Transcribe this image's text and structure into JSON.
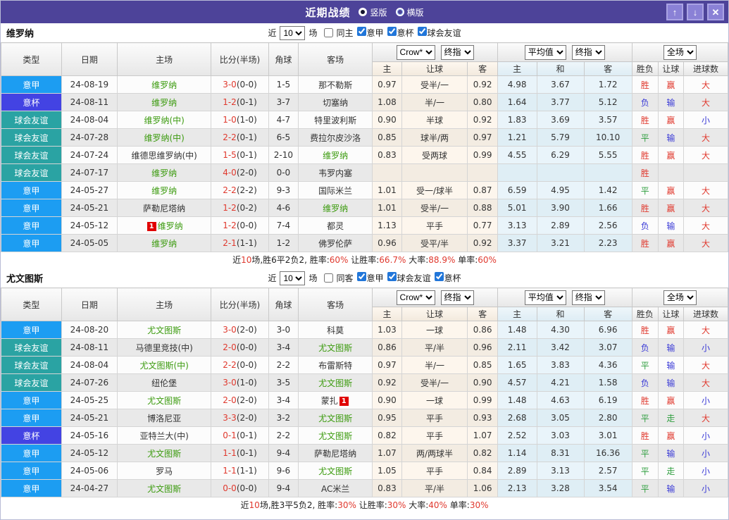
{
  "titlebar": {
    "title": "近期战绩",
    "radio_vertical": "竖版",
    "radio_horizontal": "横版",
    "up_icon": "↑",
    "down_icon": "↓",
    "close_icon": "✕"
  },
  "colors": {
    "titlebar_bg": "#4d4399",
    "league": {
      "意甲": "#1c9df2",
      "意杯": "#4343e3",
      "球会友谊": "#2aa3a3"
    },
    "focal_team_green": "#3c9b0f",
    "score_red": "#e0392e",
    "red": "#e0392e",
    "blue": "#3a3ad6",
    "green": "#2f9e3f",
    "summary_red": "#e0392e"
  },
  "table_header": {
    "left_cols": [
      "类型",
      "日期",
      "主场",
      "比分(半场)",
      "角球",
      "客场"
    ],
    "group1_selects": [
      "Crow*",
      "终指"
    ],
    "group2_selects": [
      "平均值",
      "终指"
    ],
    "group3_selects": [
      "全场"
    ],
    "sub_cols": [
      "主",
      "让球",
      "客",
      "主",
      "和",
      "客",
      "胜负",
      "让球",
      "进球数"
    ]
  },
  "filter_labels": {
    "near": "近",
    "games": "场"
  },
  "sections": [
    {
      "team": "维罗纳",
      "filter": {
        "count": "10",
        "same": "同主",
        "same_checked": false,
        "leagues": [
          "意甲",
          "意杯",
          "球会友谊"
        ]
      },
      "rows": [
        {
          "league": "意甲",
          "date": "24-08-19",
          "home": {
            "name": "维罗纳",
            "focal": true
          },
          "score_ft": "3-0",
          "score_ht": "(0-0)",
          "corners": "1-5",
          "away": {
            "name": "那不勒斯",
            "focal": false
          },
          "odds": [
            "0.97",
            "受半/一",
            "0.92"
          ],
          "avg": [
            "4.98",
            "3.67",
            "1.72"
          ],
          "results": [
            [
              "胜",
              "r"
            ],
            [
              "赢",
              "r"
            ],
            [
              "大",
              "r"
            ]
          ]
        },
        {
          "league": "意杯",
          "date": "24-08-11",
          "home": {
            "name": "维罗纳",
            "focal": true
          },
          "score_ft": "1-2",
          "score_ht": "(0-1)",
          "corners": "3-7",
          "away": {
            "name": "切塞纳",
            "focal": false
          },
          "odds": [
            "1.08",
            "半/一",
            "0.80"
          ],
          "avg": [
            "1.64",
            "3.77",
            "5.12"
          ],
          "results": [
            [
              "负",
              "b"
            ],
            [
              "输",
              "b"
            ],
            [
              "大",
              "r"
            ]
          ]
        },
        {
          "league": "球会友谊",
          "date": "24-08-04",
          "home": {
            "name": "维罗纳(中)",
            "focal": true
          },
          "score_ft": "1-0",
          "score_ht": "(1-0)",
          "corners": "4-7",
          "away": {
            "name": "特里波利斯",
            "focal": false
          },
          "odds": [
            "0.90",
            "半球",
            "0.92"
          ],
          "avg": [
            "1.83",
            "3.69",
            "3.57"
          ],
          "results": [
            [
              "胜",
              "r"
            ],
            [
              "赢",
              "r"
            ],
            [
              "小",
              "b"
            ]
          ]
        },
        {
          "league": "球会友谊",
          "date": "24-07-28",
          "home": {
            "name": "维罗纳(中)",
            "focal": true
          },
          "score_ft": "2-2",
          "score_ht": "(0-1)",
          "corners": "6-5",
          "away": {
            "name": "费拉尔皮沙洛",
            "focal": false
          },
          "odds": [
            "0.85",
            "球半/两",
            "0.97"
          ],
          "avg": [
            "1.21",
            "5.79",
            "10.10"
          ],
          "results": [
            [
              "平",
              "g"
            ],
            [
              "输",
              "b"
            ],
            [
              "大",
              "r"
            ]
          ]
        },
        {
          "league": "球会友谊",
          "date": "24-07-24",
          "home": {
            "name": "维德思维罗纳(中)",
            "focal": false
          },
          "score_ft": "1-5",
          "score_ht": "(0-1)",
          "corners": "2-10",
          "away": {
            "name": "维罗纳",
            "focal": true
          },
          "odds": [
            "0.83",
            "受两球",
            "0.99"
          ],
          "avg": [
            "4.55",
            "6.29",
            "5.55"
          ],
          "results": [
            [
              "胜",
              "r"
            ],
            [
              "赢",
              "r"
            ],
            [
              "大",
              "r"
            ]
          ]
        },
        {
          "league": "球会友谊",
          "date": "24-07-17",
          "home": {
            "name": "维罗纳",
            "focal": true
          },
          "score_ft": "4-0",
          "score_ht": "(2-0)",
          "corners": "0-0",
          "away": {
            "name": "韦罗内塞",
            "focal": false
          },
          "odds": [
            "",
            "",
            ""
          ],
          "avg": [
            "",
            "",
            ""
          ],
          "results": [
            [
              "胜",
              "r"
            ],
            [
              "",
              ""
            ],
            [
              "",
              ""
            ]
          ]
        },
        {
          "league": "意甲",
          "date": "24-05-27",
          "home": {
            "name": "维罗纳",
            "focal": true
          },
          "score_ft": "2-2",
          "score_ht": "(2-2)",
          "corners": "9-3",
          "away": {
            "name": "国际米兰",
            "focal": false
          },
          "odds": [
            "1.01",
            "受一/球半",
            "0.87"
          ],
          "avg": [
            "6.59",
            "4.95",
            "1.42"
          ],
          "results": [
            [
              "平",
              "g"
            ],
            [
              "赢",
              "r"
            ],
            [
              "大",
              "r"
            ]
          ]
        },
        {
          "league": "意甲",
          "date": "24-05-21",
          "home": {
            "name": "萨勒尼塔纳",
            "focal": false
          },
          "score_ft": "1-2",
          "score_ht": "(0-2)",
          "corners": "4-6",
          "away": {
            "name": "维罗纳",
            "focal": true
          },
          "odds": [
            "1.01",
            "受半/一",
            "0.88"
          ],
          "avg": [
            "5.01",
            "3.90",
            "1.66"
          ],
          "results": [
            [
              "胜",
              "r"
            ],
            [
              "赢",
              "r"
            ],
            [
              "大",
              "r"
            ]
          ]
        },
        {
          "league": "意甲",
          "date": "24-05-12",
          "home": {
            "name": "维罗纳",
            "focal": true,
            "card": "1",
            "card_pos": "before"
          },
          "score_ft": "1-2",
          "score_ht": "(0-0)",
          "corners": "7-4",
          "away": {
            "name": "都灵",
            "focal": false
          },
          "odds": [
            "1.13",
            "平手",
            "0.77"
          ],
          "avg": [
            "3.13",
            "2.89",
            "2.56"
          ],
          "results": [
            [
              "负",
              "b"
            ],
            [
              "输",
              "b"
            ],
            [
              "大",
              "r"
            ]
          ]
        },
        {
          "league": "意甲",
          "date": "24-05-05",
          "home": {
            "name": "维罗纳",
            "focal": true
          },
          "score_ft": "2-1",
          "score_ht": "(1-1)",
          "corners": "1-2",
          "away": {
            "name": "佛罗伦萨",
            "focal": false
          },
          "odds": [
            "0.96",
            "受平/半",
            "0.92"
          ],
          "avg": [
            "3.37",
            "3.21",
            "2.23"
          ],
          "results": [
            [
              "胜",
              "r"
            ],
            [
              "赢",
              "r"
            ],
            [
              "大",
              "r"
            ]
          ]
        }
      ],
      "summary": [
        [
          "近",
          0
        ],
        [
          "10",
          1
        ],
        [
          "场,胜6平2负2, 胜率:",
          0
        ],
        [
          "60%",
          1
        ],
        [
          " 让胜率:",
          0
        ],
        [
          "66.7%",
          1
        ],
        [
          " 大率:",
          0
        ],
        [
          "88.9%",
          1
        ],
        [
          " 单率:",
          0
        ],
        [
          "60%",
          1
        ]
      ]
    },
    {
      "team": "尤文图斯",
      "filter": {
        "count": "10",
        "same": "同客",
        "same_checked": false,
        "leagues": [
          "意甲",
          "球会友谊",
          "意杯"
        ]
      },
      "rows": [
        {
          "league": "意甲",
          "date": "24-08-20",
          "home": {
            "name": "尤文图斯",
            "focal": true
          },
          "score_ft": "3-0",
          "score_ht": "(2-0)",
          "corners": "3-0",
          "away": {
            "name": "科莫",
            "focal": false
          },
          "odds": [
            "1.03",
            "一球",
            "0.86"
          ],
          "avg": [
            "1.48",
            "4.30",
            "6.96"
          ],
          "results": [
            [
              "胜",
              "r"
            ],
            [
              "赢",
              "r"
            ],
            [
              "大",
              "r"
            ]
          ]
        },
        {
          "league": "球会友谊",
          "date": "24-08-11",
          "home": {
            "name": "马德里竞技(中)",
            "focal": false
          },
          "score_ft": "2-0",
          "score_ht": "(0-0)",
          "corners": "3-4",
          "away": {
            "name": "尤文图斯",
            "focal": true
          },
          "odds": [
            "0.86",
            "平/半",
            "0.96"
          ],
          "avg": [
            "2.11",
            "3.42",
            "3.07"
          ],
          "results": [
            [
              "负",
              "b"
            ],
            [
              "输",
              "b"
            ],
            [
              "小",
              "b"
            ]
          ]
        },
        {
          "league": "球会友谊",
          "date": "24-08-04",
          "home": {
            "name": "尤文图斯(中)",
            "focal": true
          },
          "score_ft": "2-2",
          "score_ht": "(0-0)",
          "corners": "2-2",
          "away": {
            "name": "布雷斯特",
            "focal": false
          },
          "odds": [
            "0.97",
            "半/一",
            "0.85"
          ],
          "avg": [
            "1.65",
            "3.83",
            "4.36"
          ],
          "results": [
            [
              "平",
              "g"
            ],
            [
              "输",
              "b"
            ],
            [
              "大",
              "r"
            ]
          ]
        },
        {
          "league": "球会友谊",
          "date": "24-07-26",
          "home": {
            "name": "纽伦堡",
            "focal": false
          },
          "score_ft": "3-0",
          "score_ht": "(1-0)",
          "corners": "3-5",
          "away": {
            "name": "尤文图斯",
            "focal": true
          },
          "odds": [
            "0.92",
            "受半/一",
            "0.90"
          ],
          "avg": [
            "4.57",
            "4.21",
            "1.58"
          ],
          "results": [
            [
              "负",
              "b"
            ],
            [
              "输",
              "b"
            ],
            [
              "大",
              "r"
            ]
          ]
        },
        {
          "league": "意甲",
          "date": "24-05-25",
          "home": {
            "name": "尤文图斯",
            "focal": true
          },
          "score_ft": "2-0",
          "score_ht": "(2-0)",
          "corners": "3-4",
          "away": {
            "name": "蒙扎",
            "focal": false,
            "card": "1",
            "card_pos": "after"
          },
          "odds": [
            "0.90",
            "一球",
            "0.99"
          ],
          "avg": [
            "1.48",
            "4.63",
            "6.19"
          ],
          "results": [
            [
              "胜",
              "r"
            ],
            [
              "赢",
              "r"
            ],
            [
              "小",
              "b"
            ]
          ]
        },
        {
          "league": "意甲",
          "date": "24-05-21",
          "home": {
            "name": "博洛尼亚",
            "focal": false
          },
          "score_ft": "3-3",
          "score_ht": "(2-0)",
          "corners": "3-2",
          "away": {
            "name": "尤文图斯",
            "focal": true
          },
          "odds": [
            "0.95",
            "平手",
            "0.93"
          ],
          "avg": [
            "2.68",
            "3.05",
            "2.80"
          ],
          "results": [
            [
              "平",
              "g"
            ],
            [
              "走",
              "g"
            ],
            [
              "大",
              "r"
            ]
          ]
        },
        {
          "league": "意杯",
          "date": "24-05-16",
          "home": {
            "name": "亚特兰大(中)",
            "focal": false
          },
          "score_ft": "0-1",
          "score_ht": "(0-1)",
          "corners": "2-2",
          "away": {
            "name": "尤文图斯",
            "focal": true
          },
          "odds": [
            "0.82",
            "平手",
            "1.07"
          ],
          "avg": [
            "2.52",
            "3.03",
            "3.01"
          ],
          "results": [
            [
              "胜",
              "r"
            ],
            [
              "赢",
              "r"
            ],
            [
              "小",
              "b"
            ]
          ]
        },
        {
          "league": "意甲",
          "date": "24-05-12",
          "home": {
            "name": "尤文图斯",
            "focal": true
          },
          "score_ft": "1-1",
          "score_ht": "(0-1)",
          "corners": "9-4",
          "away": {
            "name": "萨勒尼塔纳",
            "focal": false
          },
          "odds": [
            "1.07",
            "两/两球半",
            "0.82"
          ],
          "avg": [
            "1.14",
            "8.31",
            "16.36"
          ],
          "results": [
            [
              "平",
              "g"
            ],
            [
              "输",
              "b"
            ],
            [
              "小",
              "b"
            ]
          ]
        },
        {
          "league": "意甲",
          "date": "24-05-06",
          "home": {
            "name": "罗马",
            "focal": false
          },
          "score_ft": "1-1",
          "score_ht": "(1-1)",
          "corners": "9-6",
          "away": {
            "name": "尤文图斯",
            "focal": true
          },
          "odds": [
            "1.05",
            "平手",
            "0.84"
          ],
          "avg": [
            "2.89",
            "3.13",
            "2.57"
          ],
          "results": [
            [
              "平",
              "g"
            ],
            [
              "走",
              "g"
            ],
            [
              "小",
              "b"
            ]
          ]
        },
        {
          "league": "意甲",
          "date": "24-04-27",
          "home": {
            "name": "尤文图斯",
            "focal": true
          },
          "score_ft": "0-0",
          "score_ht": "(0-0)",
          "corners": "9-4",
          "away": {
            "name": "AC米兰",
            "focal": false
          },
          "odds": [
            "0.83",
            "平/半",
            "1.06"
          ],
          "avg": [
            "2.13",
            "3.28",
            "3.54"
          ],
          "results": [
            [
              "平",
              "g"
            ],
            [
              "输",
              "b"
            ],
            [
              "小",
              "b"
            ]
          ]
        }
      ],
      "summary": [
        [
          "近",
          0
        ],
        [
          "10",
          1
        ],
        [
          "场,胜3平5负2, 胜率:",
          0
        ],
        [
          "30%",
          1
        ],
        [
          " 让胜率:",
          0
        ],
        [
          "30%",
          1
        ],
        [
          " 大率:",
          0
        ],
        [
          "40%",
          1
        ],
        [
          " 单率:",
          0
        ],
        [
          "30%",
          1
        ]
      ]
    }
  ]
}
